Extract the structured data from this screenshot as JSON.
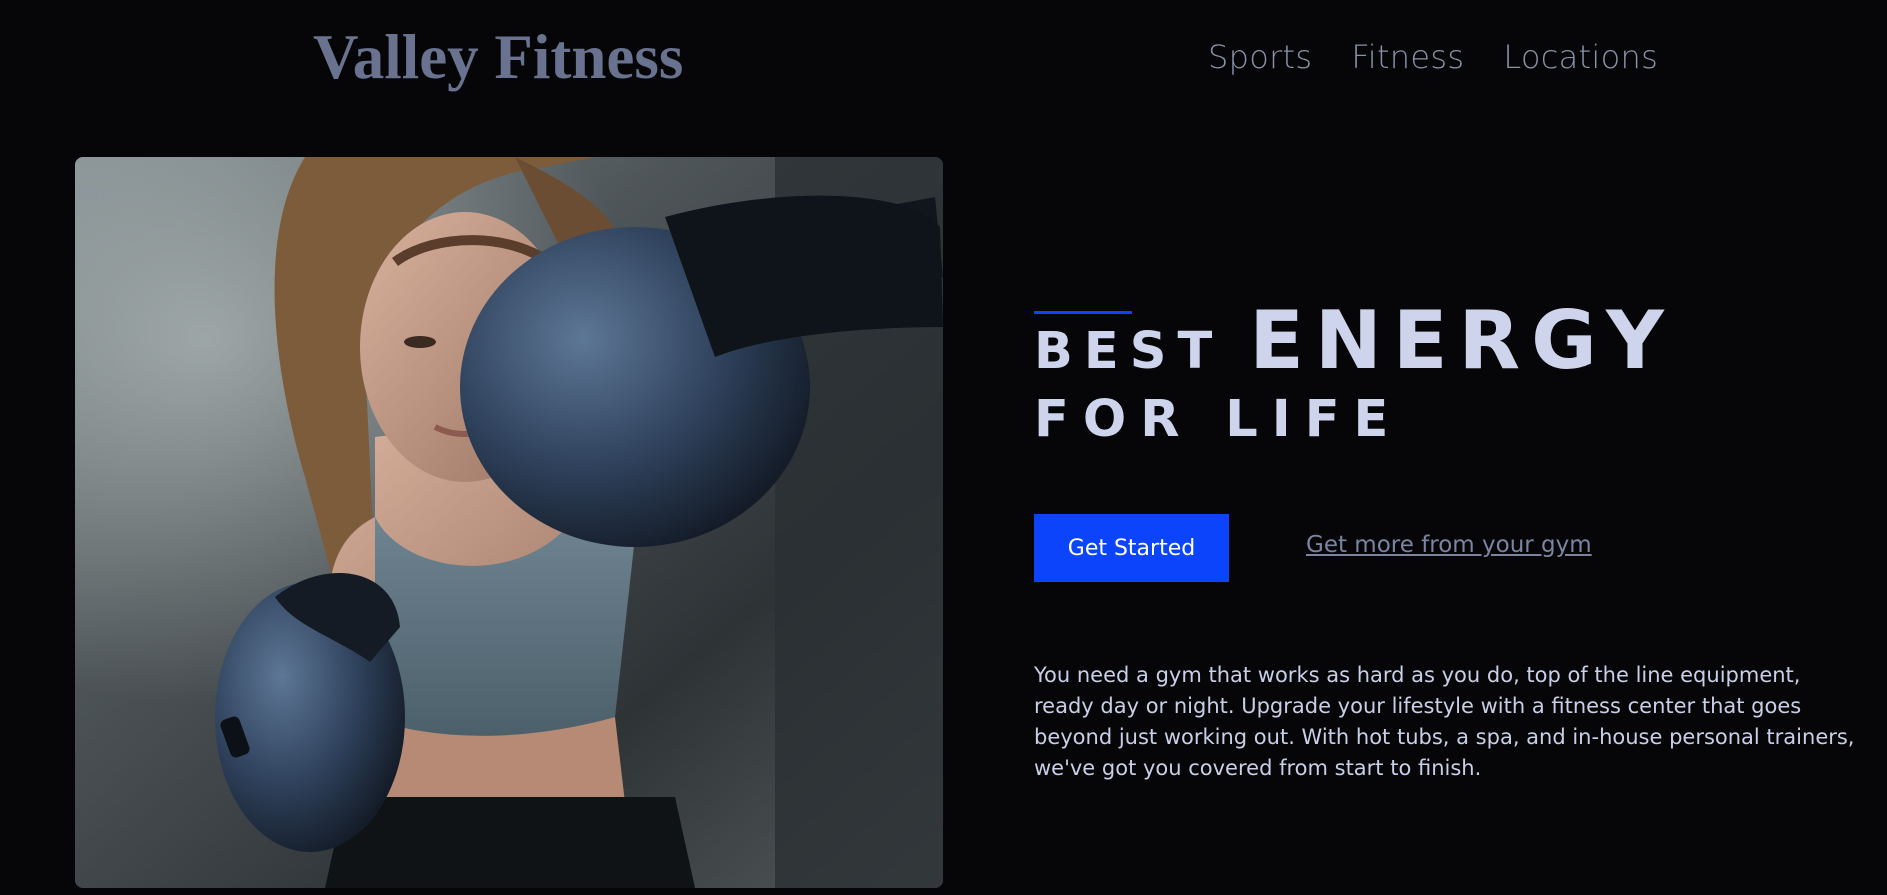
{
  "header": {
    "logo": "Valley Fitness",
    "nav": [
      "Sports",
      "Fitness",
      "Locations"
    ]
  },
  "hero": {
    "image_alt": "text",
    "headline": {
      "best": "BEST",
      "energy": "ENERGY",
      "for_life": "FOR LIFE"
    },
    "cta_label": "Get Started",
    "link_label": "Get more from your gym",
    "description": "You need a gym that works as hard as you do, top of the line equipment, ready day or night. Upgrade your lifestyle with a fitness center that goes beyond just working out. With hot tubs, a spa, and in-house personal trainers, we've got you covered from start to finish."
  },
  "colors": {
    "accent": "#0c44fb",
    "background": "#060608"
  }
}
